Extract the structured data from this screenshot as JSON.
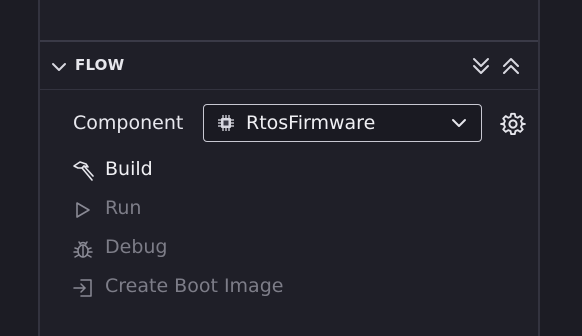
{
  "flow": {
    "title": "FLOW",
    "component_label": "Component",
    "component_value": "RtosFirmware",
    "actions": [
      {
        "label": "Build",
        "enabled": true
      },
      {
        "label": "Run",
        "enabled": false
      },
      {
        "label": "Debug",
        "enabled": false
      },
      {
        "label": "Create Boot Image",
        "enabled": false
      }
    ]
  },
  "icons": {
    "section_toggle": "chevron-down-icon",
    "expand_all": "double-chevron-down-icon",
    "collapse_all": "double-chevron-up-icon",
    "component_chip": "chip-icon",
    "select_dropdown": "chevron-down-icon",
    "settings": "gear-icon",
    "build": "hammer-icon",
    "run": "play-icon",
    "debug": "bug-icon",
    "boot_image": "sign-in-icon"
  },
  "colors": {
    "background": "#1f1f28",
    "text_primary": "#f0f0f4",
    "text_disabled": "#7d7d88",
    "border": "#c8c8d2"
  }
}
